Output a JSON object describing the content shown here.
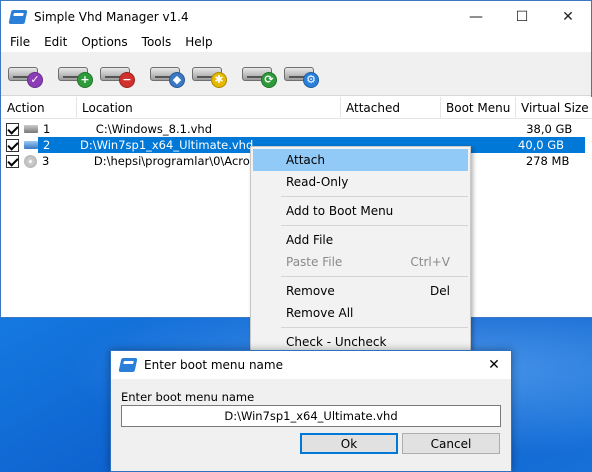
{
  "window": {
    "title": "Simple Vhd Manager v1.4",
    "controls": {
      "minimize": "—",
      "maximize": "☐",
      "close": "✕"
    }
  },
  "menu": [
    "File",
    "Edit",
    "Options",
    "Tools",
    "Help"
  ],
  "toolbar": [
    {
      "icon": "drive-check-icon",
      "badge": "✓",
      "badge_color": "#8b3db8"
    },
    {
      "icon": "drive-add-icon",
      "badge": "+",
      "badge_color": "#2e9b3a"
    },
    {
      "icon": "drive-remove-icon",
      "badge": "−",
      "badge_color": "#d0312d"
    },
    {
      "icon": "drive-attach-icon",
      "badge": "◆",
      "badge_color": "#3a78c4"
    },
    {
      "icon": "drive-settings-icon",
      "badge": "✱",
      "badge_color": "#e6b800"
    },
    {
      "icon": "drive-refresh-icon",
      "badge": "⟳",
      "badge_color": "#2e9b3a"
    },
    {
      "icon": "drive-tools-icon",
      "badge": "⚙",
      "badge_color": "#2a7fd8"
    }
  ],
  "list": {
    "columns": [
      "Action",
      "Location",
      "Attached",
      "Boot Menu",
      "Virtual Size"
    ],
    "rows": [
      {
        "num": "1",
        "location": "C:\\Windows_8.1.vhd",
        "attached": "",
        "boot_menu": "",
        "size": "38,0 GB",
        "icon": "drive"
      },
      {
        "num": "2",
        "location": "D:\\Win7sp1_x64_Ultimate.vhd",
        "attached": "",
        "boot_menu": "",
        "size": "40,0 GB",
        "icon": "drive-blue"
      },
      {
        "num": "3",
        "location": "D:\\hepsi\\programlar\\0\\Acronis\\old\\",
        "attached": "",
        "boot_menu": "",
        "size": "278 MB",
        "icon": "disc"
      }
    ]
  },
  "context_menu": {
    "attach": "Attach",
    "read_only": "Read-Only",
    "add_boot": "Add to Boot Menu",
    "add_file": "Add File",
    "paste_file": "Paste File",
    "paste_shortcut": "Ctrl+V",
    "remove": "Remove",
    "remove_shortcut": "Del",
    "remove_all": "Remove All",
    "check_uncheck": "Check - Uncheck"
  },
  "dialog": {
    "title": "Enter boot menu name",
    "label": "Enter boot menu name",
    "value": "D:\\Win7sp1_x64_Ultimate.vhd",
    "ok": "Ok",
    "cancel": "Cancel",
    "close": "✕"
  }
}
